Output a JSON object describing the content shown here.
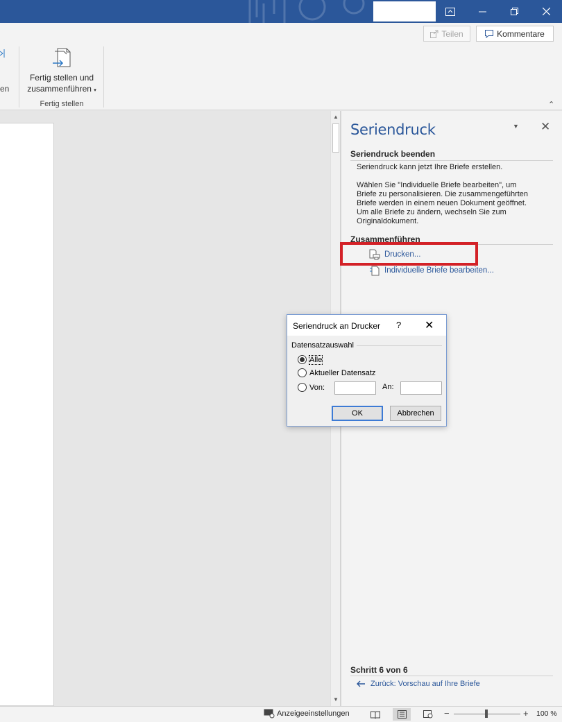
{
  "ribbon": {
    "share_label": "Teilen",
    "comments_label": "Kommentare",
    "truncated_label": "en",
    "finish_button": {
      "line1": "Fertig stellen und",
      "line2": "zusammenführen"
    },
    "group_label": "Fertig stellen"
  },
  "taskpane": {
    "title": "Seriendruck",
    "section1_heading": "Seriendruck beenden",
    "intro_text": "Seriendruck kann jetzt Ihre Briefe erstellen.",
    "body_lines": [
      "Wählen Sie \"Individuelle Briefe bearbeiten\", um",
      "Briefe zu personalisieren. Die zusammengeführten",
      "Briefe werden in einem neuen Dokument geöffnet.",
      "Um alle Briefe zu ändern, wechseln Sie zum",
      "Originaldokument."
    ],
    "section2_heading": "Zusammenführen",
    "link_print": "Drucken...",
    "link_edit": "Individuelle Briefe bearbeiten...",
    "step_label": "Schritt 6 von 6",
    "back_link": "Zurück: Vorschau auf Ihre Briefe",
    "highlight_color": "#d32127"
  },
  "dialog": {
    "title": "Seriendruck an Drucker",
    "help": "?",
    "group_label": "Datensatzauswahl",
    "options": [
      {
        "label": "Alle",
        "checked": true
      },
      {
        "label": "Aktueller Datensatz",
        "checked": false
      },
      {
        "label": "Von:",
        "checked": false
      }
    ],
    "from_value": "",
    "to_label": "An:",
    "to_value": "",
    "ok_label": "OK",
    "cancel_label": "Abbrechen"
  },
  "statusbar": {
    "display_settings": "Anzeigeeinstellungen",
    "zoom_percent": "100 %",
    "zoom_level": 100
  },
  "colors": {
    "titlebar": "#2b579a",
    "accent": "#2b579a"
  }
}
